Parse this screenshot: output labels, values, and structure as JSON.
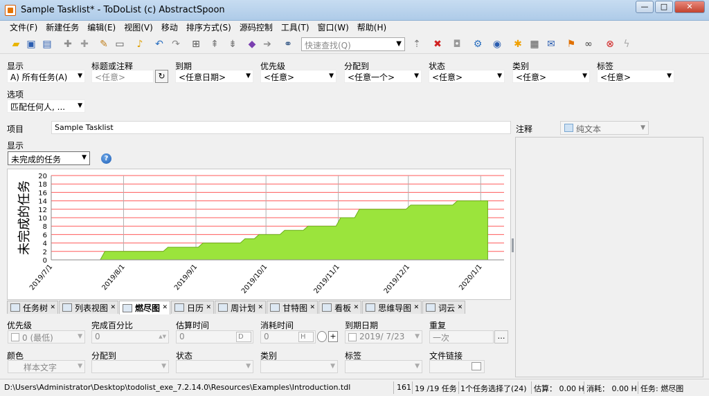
{
  "window": {
    "title": "Sample Tasklist* - ToDoList (c) AbstractSpoon",
    "buttons": {
      "minimize": "—",
      "maximize": "□",
      "close": "✕"
    }
  },
  "menu": [
    "文件(F)",
    "新建任务",
    "编辑(E)",
    "视图(V)",
    "移动",
    "排序方式(S)",
    "源码控制",
    "工具(T)",
    "窗口(W)",
    "帮助(H)"
  ],
  "toolbar": {
    "quickfind_placeholder": "快速查找(Q)",
    "icons": [
      "open-folder-icon",
      "save-icon",
      "save-all-icon",
      "add-task-icon",
      "add-subtask-icon",
      "edit-icon",
      "note-icon",
      "reminder-bell-icon",
      "undo-icon",
      "redo-icon",
      "expand-icon",
      "move-up-icon",
      "move-down-icon",
      "arrow-left-icon",
      "arrow-right-icon",
      "binoculars-icon",
      "sort-icon",
      "delete-icon",
      "lock-icon",
      "settings-icon",
      "help-icon",
      "star-icon",
      "print-icon",
      "email-icon",
      "flag-icon",
      "link-icon",
      "exit-icon",
      "lightning-icon"
    ]
  },
  "filters": {
    "show": {
      "label": "显示",
      "value": "A)  所有任务(A)"
    },
    "title": {
      "label": "标题或注释",
      "placeholder": "<任意>"
    },
    "due": {
      "label": "到期",
      "value": "<任意日期>"
    },
    "priority": {
      "label": "优先级",
      "value": "<任意>"
    },
    "allocated": {
      "label": "分配到",
      "value": "<任意一个>"
    },
    "status": {
      "label": "状态",
      "value": "<任意>"
    },
    "category": {
      "label": "类别",
      "value": "<任意>"
    },
    "tags": {
      "label": "标签",
      "value": "<任意>"
    },
    "options": {
      "label": "选项",
      "value": "匹配任何人, ..."
    }
  },
  "project": {
    "label": "项目",
    "value": "Sample Tasklist",
    "notes_label": "注释",
    "notes_format": "纯文本"
  },
  "display": {
    "label": "显示",
    "value": "未完成的任务"
  },
  "chart_data": {
    "type": "area",
    "title": "",
    "ylabel": "未完成的任务",
    "xlabel": "",
    "ylim": [
      0,
      20
    ],
    "yticks": [
      0,
      2,
      4,
      6,
      8,
      10,
      12,
      14,
      16,
      18,
      20
    ],
    "xlim": [
      "2019/7/1",
      "2020/1/11"
    ],
    "xticks": [
      "2019/7/1",
      "2019/8/1",
      "2019/9/1",
      "2019/10/1",
      "2019/11/1",
      "2019/12/1",
      "2020/1/1"
    ],
    "grid": true,
    "fill_color": "#9be43c",
    "series": [
      {
        "x": [
          "2019/7/1",
          "2019/7/22",
          "2019/7/24",
          "2019/8/18",
          "2019/8/20",
          "2019/9/2",
          "2019/9/4",
          "2019/9/20",
          "2019/9/22",
          "2019/9/26",
          "2019/9/28",
          "2019/10/7",
          "2019/10/9",
          "2019/10/17",
          "2019/10/19",
          "2019/10/24",
          "2019/10/26",
          "2019/10/31",
          "2019/11/2",
          "2019/11/8",
          "2019/11/10",
          "2019/11/30",
          "2019/12/2",
          "2019/12/20",
          "2019/12/22",
          "2020/1/4"
        ],
        "values": [
          0,
          0,
          2,
          2,
          3,
          3,
          4,
          4,
          5,
          5,
          6,
          6,
          7,
          7,
          8,
          8,
          8,
          8,
          10,
          10,
          12,
          12,
          13,
          13,
          14,
          14
        ]
      }
    ]
  },
  "view_tabs": [
    {
      "label": "任务树",
      "icon": "task-tree-icon"
    },
    {
      "label": "列表视图",
      "icon": "list-view-icon"
    },
    {
      "label": "燃尽图",
      "icon": "burndown-icon"
    },
    {
      "label": "日历",
      "icon": "calendar-icon"
    },
    {
      "label": "周计划",
      "icon": "week-planner-icon"
    },
    {
      "label": "甘特图",
      "icon": "gantt-icon"
    },
    {
      "label": "看板",
      "icon": "kanban-icon"
    },
    {
      "label": "思维导图",
      "icon": "mindmap-icon"
    },
    {
      "label": "词云",
      "icon": "word-cloud-icon"
    }
  ],
  "attributes": {
    "priority": {
      "label": "优先级",
      "value": "0 (最低)"
    },
    "percent": {
      "label": "完成百分比",
      "value": "0"
    },
    "estimate": {
      "label": "估算时间",
      "value": "0",
      "unit": "D"
    },
    "spent": {
      "label": "消耗时间",
      "value": "0",
      "unit": "H"
    },
    "due_date": {
      "label": "到期日期",
      "value": "2019/  7/23"
    },
    "recurrence": {
      "label": "重复",
      "value": "一次"
    },
    "color": {
      "label": "颜色",
      "value": "样本文字"
    },
    "allocated": {
      "label": "分配到",
      "value": ""
    },
    "status": {
      "label": "状态",
      "value": ""
    },
    "category": {
      "label": "类别",
      "value": ""
    },
    "tags": {
      "label": "标签",
      "value": ""
    },
    "file_link": {
      "label": "文件链接",
      "value": ""
    }
  },
  "statusbar": {
    "path": "D:\\Users\\Administrator\\Desktop\\todolist_exe_7.2.14.0\\Resources\\Examples\\Introduction.tdl",
    "count": "161",
    "tasks": "19 /19 任务",
    "selected": "1个任务选择了(24)",
    "estimate": "估算： 0.00 H",
    "spent": "消耗： 0.00 H",
    "view": "任务: 燃尽图"
  }
}
